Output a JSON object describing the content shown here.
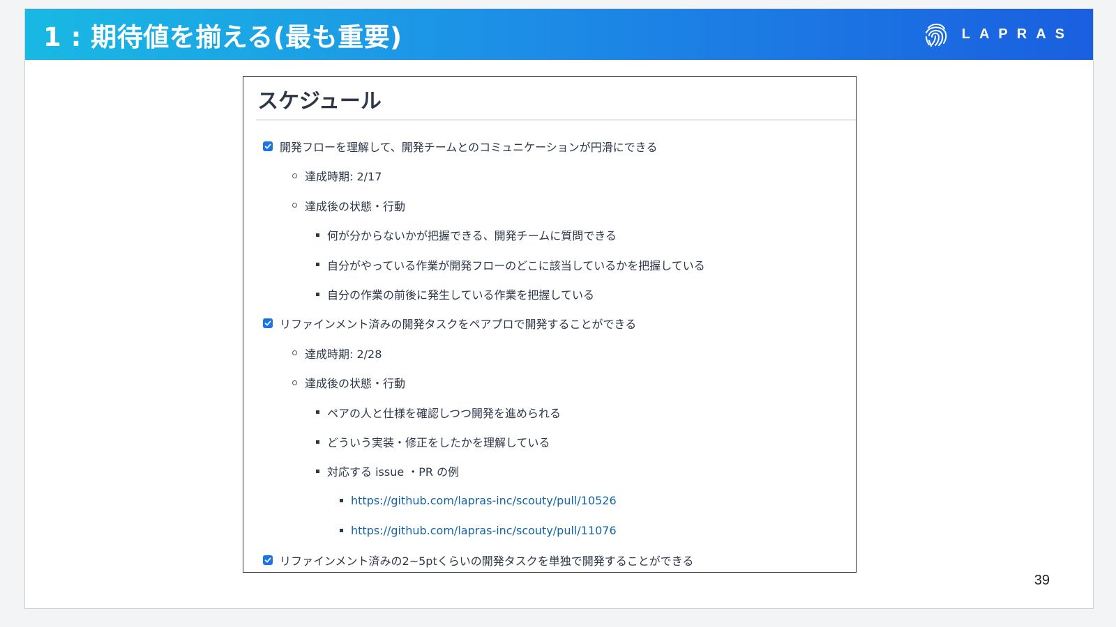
{
  "header": {
    "title": "1 : 期待値を揃える(最も重要)",
    "brand_name": "LAPRAS",
    "brand_icon": "fingerprint-icon"
  },
  "doc": {
    "heading": "スケジュール",
    "items": [
      {
        "level": 0,
        "marker": "checkbox",
        "checked": true,
        "text": "開発フローを理解して、開発チームとのコミュニケーションが円滑にできる"
      },
      {
        "level": 1,
        "marker": "circle",
        "text": "達成時期: 2/17"
      },
      {
        "level": 1,
        "marker": "circle",
        "text": "達成後の状態・行動"
      },
      {
        "level": 2,
        "marker": "square",
        "text": "何が分からないかが把握できる、開発チームに質問できる"
      },
      {
        "level": 2,
        "marker": "square",
        "text": "自分がやっている作業が開発フローのどこに該当しているかを把握している"
      },
      {
        "level": 2,
        "marker": "square",
        "text": "自分の作業の前後に発生している作業を把握している"
      },
      {
        "level": 0,
        "marker": "checkbox",
        "checked": true,
        "text": "リファインメント済みの開発タスクをペアプロで開発することができる"
      },
      {
        "level": 1,
        "marker": "circle",
        "text": "達成時期: 2/28"
      },
      {
        "level": 1,
        "marker": "circle",
        "text": "達成後の状態・行動"
      },
      {
        "level": 2,
        "marker": "square",
        "text": "ペアの人と仕様を確認しつつ開発を進められる"
      },
      {
        "level": 2,
        "marker": "square",
        "text": "どういう実装・修正をしたかを理解している"
      },
      {
        "level": 2,
        "marker": "square",
        "text": "対応する issue ・PR の例"
      },
      {
        "level": 3,
        "marker": "square",
        "link": true,
        "text": "https://github.com/lapras-inc/scouty/pull/10526"
      },
      {
        "level": 3,
        "marker": "square",
        "link": true,
        "text": "https://github.com/lapras-inc/scouty/pull/11076"
      },
      {
        "level": 0,
        "marker": "checkbox",
        "checked": true,
        "text": "リファインメント済みの2~5ptくらいの開発タスクを単独で開発することができる"
      }
    ]
  },
  "footer": {
    "page_number": "39"
  },
  "colors": {
    "header_gradient_start": "#19b9e4",
    "header_gradient_end": "#1a5fe0",
    "checkbox": "#1a73e8",
    "link": "#1465a8",
    "text": "#2d3748"
  }
}
